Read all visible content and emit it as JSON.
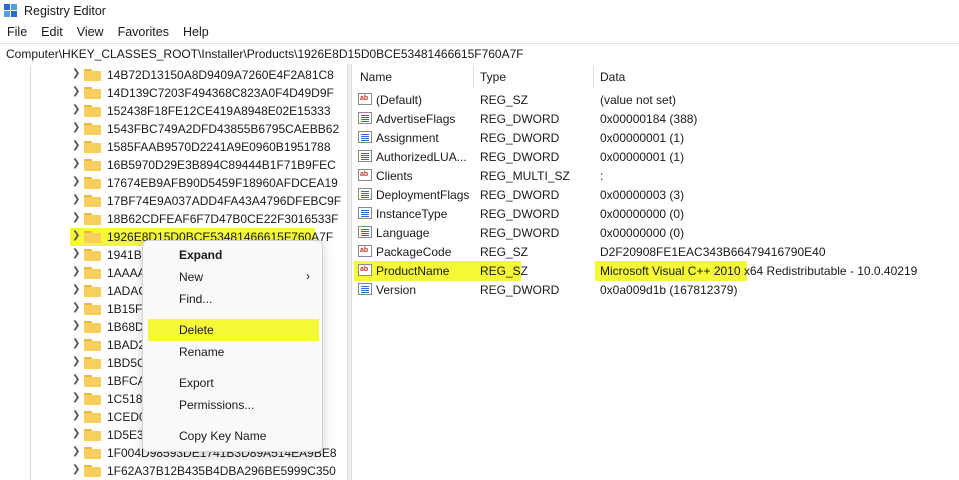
{
  "window": {
    "title": "Registry Editor"
  },
  "menu": [
    "File",
    "Edit",
    "View",
    "Favorites",
    "Help"
  ],
  "address": "Computer\\HKEY_CLASSES_ROOT\\Installer\\Products\\1926E8D15D0BCE53481466615F760A7F",
  "tree": {
    "items": [
      "14B72D13150A8D9409A7260E4F2A81C8",
      "14D139C7203F494368C823A0F4D49D9F",
      "152438F18FE12CE419A8948E02E15333",
      "1543FBC749A2DFD43855B6795CAEBB62",
      "1585FAAB9570D2241A9E0960B1951788",
      "16B5970D29E3B894C89444B1F71B9FEC",
      "17674EB9AFB90D5459F18960AFDCEA19",
      "17BF74E9A037ADD4FA43A4796DFEBC9F",
      "18B62CDFEAF6F7D47B0CE22F3016533F",
      "1926E8D15D0BCE53481466615F760A7F",
      "1941B4",
      "1AAAA",
      "1ADAC",
      "1B15F4",
      "1B68DA",
      "1BAD2",
      "1BD5C",
      "1BFCA",
      "1C518",
      "1CED0",
      "1D5E3C",
      "1F004D98593DE1741B3D89A514EA9BE8",
      "1F62A37B12B435B4DBA296BE5999C350"
    ],
    "selected_index": 9
  },
  "values": {
    "headers": {
      "name": "Name",
      "type": "Type",
      "data": "Data"
    },
    "rows": [
      {
        "name": "(Default)",
        "type": "REG_SZ",
        "data": "(value not set)",
        "icon": "string-value-icon"
      },
      {
        "name": "AdvertiseFlags",
        "type": "REG_DWORD",
        "data": "0x00000184 (388)",
        "icon": "binary-value-icon"
      },
      {
        "name": "Assignment",
        "type": "REG_DWORD",
        "data": "0x00000001 (1)",
        "icon": "binary-value-icon"
      },
      {
        "name": "AuthorizedLUA...",
        "type": "REG_DWORD",
        "data": "0x00000001 (1)",
        "icon": "binary-value-icon"
      },
      {
        "name": "Clients",
        "type": "REG_MULTI_SZ",
        "data": ":",
        "icon": "string-value-icon"
      },
      {
        "name": "DeploymentFlags",
        "type": "REG_DWORD",
        "data": "0x00000003 (3)",
        "icon": "binary-value-icon"
      },
      {
        "name": "InstanceType",
        "type": "REG_DWORD",
        "data": "0x00000000 (0)",
        "icon": "binary-value-icon"
      },
      {
        "name": "Language",
        "type": "REG_DWORD",
        "data": "0x00000000 (0)",
        "icon": "binary-value-icon"
      },
      {
        "name": "PackageCode",
        "type": "REG_SZ",
        "data": "D2F20908FE1EAC343B66479416790E40",
        "icon": "string-value-icon"
      },
      {
        "name": "ProductName",
        "type": "REG_SZ",
        "data": "Microsoft Visual C++ 2010  x64 Redistributable - 10.0.40219",
        "icon": "string-value-icon"
      },
      {
        "name": "Version",
        "type": "REG_DWORD",
        "data": "0x0a009d1b (167812379)",
        "icon": "binary-value-icon"
      }
    ],
    "highlighted_index": 9
  },
  "context_menu": {
    "items": [
      {
        "label": "Expand",
        "bold": true
      },
      {
        "label": "New",
        "submenu": true
      },
      {
        "label": "Find..."
      },
      {
        "label": "Delete",
        "highlighted": true
      },
      {
        "label": "Rename"
      },
      {
        "label": "Export"
      },
      {
        "label": "Permissions..."
      },
      {
        "label": "Copy Key Name"
      }
    ]
  },
  "colors": {
    "highlight": "#f4f836",
    "folder": "#f8cf5c",
    "accent": "#2b6cd4"
  }
}
